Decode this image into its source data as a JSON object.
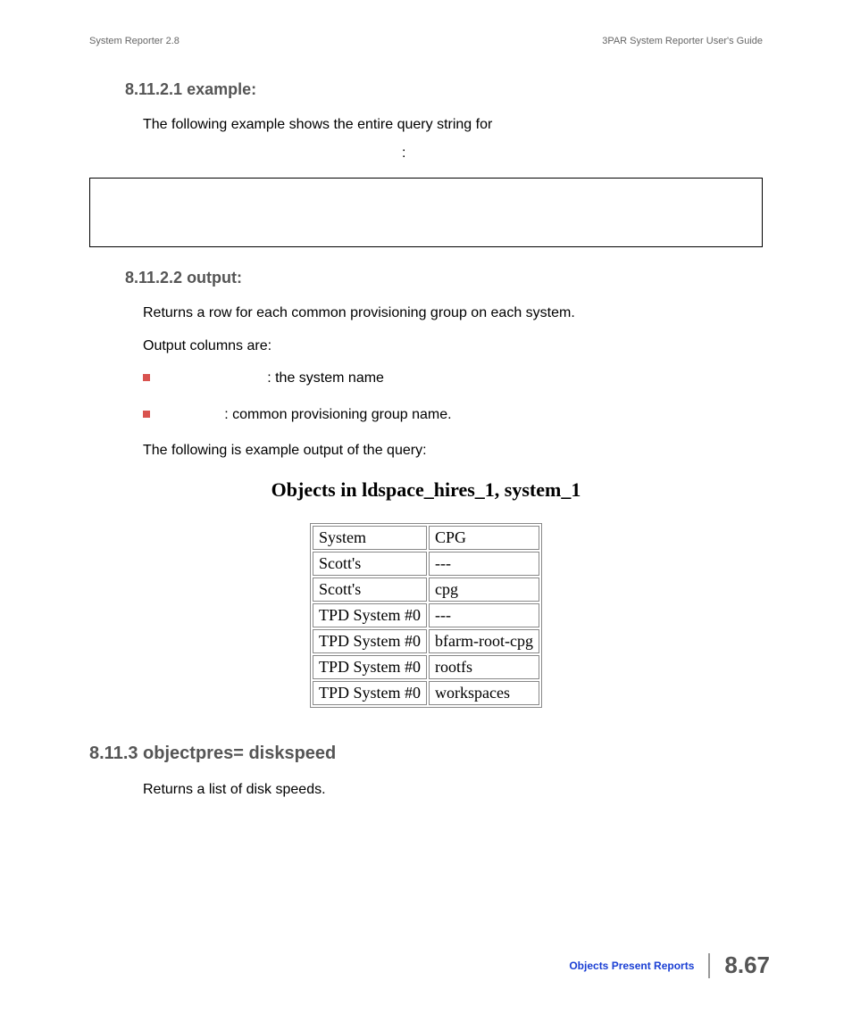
{
  "header": {
    "left": "System Reporter 2.8",
    "right": "3PAR System Reporter User's Guide"
  },
  "section_example": {
    "heading": "8.11.2.1 example:",
    "intro": "The following example shows the entire query string for",
    "intro_continue": ":"
  },
  "section_output": {
    "heading": "8.11.2.2 output:",
    "line1": "Returns a row for each common provisioning group on each system.",
    "line2": "Output columns are:",
    "bullets": [
      {
        "spacer": "            ",
        "text": ": the system name"
      },
      {
        "spacer": "       ",
        "text": ": common provisioning group name."
      }
    ],
    "line3": "The following is example output of the query:"
  },
  "table": {
    "title": "Objects in ldspace_hires_1, system_1",
    "rows": [
      [
        "System",
        "CPG"
      ],
      [
        "Scott's",
        "---"
      ],
      [
        "Scott's",
        "cpg"
      ],
      [
        "TPD System #0",
        "---"
      ],
      [
        "TPD System #0",
        "bfarm-root-cpg"
      ],
      [
        "TPD System #0",
        "rootfs"
      ],
      [
        "TPD System #0",
        "workspaces"
      ]
    ]
  },
  "section_diskspeed": {
    "heading": "8.11.3 objectpres= diskspeed",
    "text": "Returns a list of disk speeds."
  },
  "footer": {
    "label": "Objects Present Reports",
    "page": "8.67"
  }
}
